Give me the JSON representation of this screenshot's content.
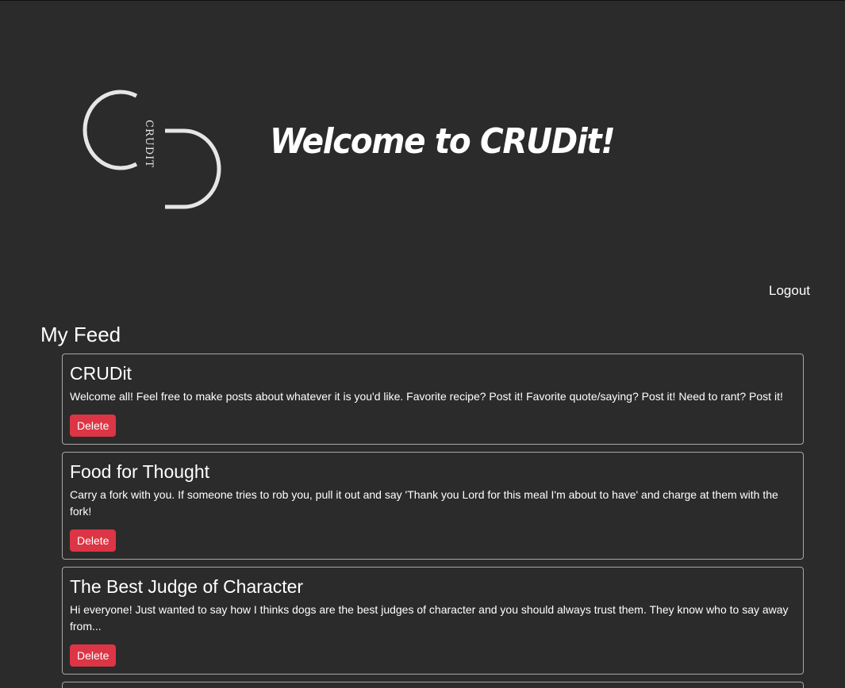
{
  "header": {
    "logo": {
      "icon": "crudit-logo",
      "text": "CRUDIT"
    },
    "title": "Welcome to CRUDit!"
  },
  "nav": {
    "logout_label": "Logout"
  },
  "feed": {
    "heading": "My Feed",
    "posts": [
      {
        "title": "CRUDit",
        "body": "Welcome all! Feel free to make posts about whatever it is you'd like. Favorite recipe? Post it! Favorite quote/saying? Post it! Need to rant? Post it!",
        "delete_label": "Delete"
      },
      {
        "title": "Food for Thought",
        "body": "Carry a fork with you. If someone tries to rob you, pull it out and say 'Thank you Lord for this meal I'm about to have' and charge at them with the fork!",
        "delete_label": "Delete"
      },
      {
        "title": "The Best Judge of Character",
        "body": "Hi everyone! Just wanted to say how I thinks dogs are the best judges of character and you should always trust them. They know who to say away from...",
        "delete_label": "Delete"
      }
    ]
  },
  "colors": {
    "background": "#2b2b2b",
    "card_border": "#a8a8a8",
    "delete_button": "#dc3545",
    "text": "#ffffff"
  }
}
